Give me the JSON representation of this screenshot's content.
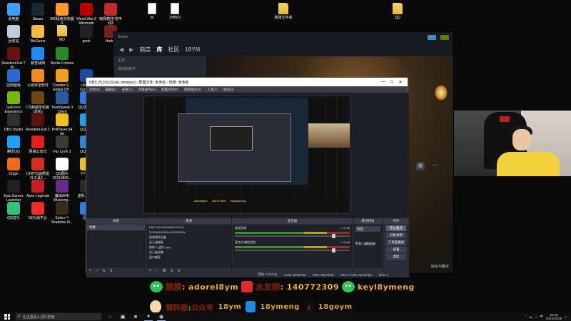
{
  "desktop": {
    "icons": [
      {
        "label": "此电脑",
        "color": "#3aa0ff"
      },
      {
        "label": "Steam",
        "color": "#1b2838"
      },
      {
        "label": "360极速浏览器X",
        "color": "#ff9a2a"
      },
      {
        "label": "World War Z Aftermath",
        "color": "#b00"
      },
      {
        "label": "暗网疯狂•地平线4",
        "color": "#c02a2a"
      },
      {
        "label": "回收站",
        "color": "#bcd"
      },
      {
        "label": "WeGame",
        "color": "#f4b942"
      },
      {
        "label": "MD",
        "color": "folder"
      },
      {
        "label": "geek",
        "color": "#222"
      },
      {
        "label": "Hades",
        "color": "#7a2020"
      },
      {
        "label": "Resident Evil 7 Bi...",
        "color": "#6a1010"
      },
      {
        "label": "暴雪战网",
        "color": "#1a8cff"
      },
      {
        "label": "Revits Fortune -...",
        "color": "#2a8a2a"
      },
      {
        "label": "控制面板",
        "color": "#2a6ad0"
      },
      {
        "label": "火绒安全软件",
        "color": "#f08a1a"
      },
      {
        "label": "Counter-S... Global Off...",
        "color": "#f0a020"
      },
      {
        "label": "Ubisoft Connect",
        "color": "#1a4aa0"
      },
      {
        "label": "GeForce Experience",
        "color": "#76b900"
      },
      {
        "label": "CS跑腿单机版(单机)",
        "color": "#6a4a10"
      },
      {
        "label": "TeamSpeak 3 Client",
        "color": "#2a5aa0"
      },
      {
        "label": "QQ浏览器",
        "color": "#2a7ae2"
      },
      {
        "label": "OBS Studio",
        "color": "#302e31"
      },
      {
        "label": "Resident Evil 2",
        "color": "#601010"
      },
      {
        "label": "PotPlayer 64 bit",
        "color": "#f0c020"
      },
      {
        "label": "QQ游戏",
        "color": "#2a9ae2"
      },
      {
        "label": "腾讯QQ",
        "color": "#1aa0ff"
      },
      {
        "label": "网易云音乐",
        "color": "#e02020"
      },
      {
        "label": "Far Cry® 3",
        "color": "#3a3a3a"
      },
      {
        "label": "QQ影音",
        "color": "#2a8ad0"
      },
      {
        "label": "Origin",
        "color": "#f06a1a"
      },
      {
        "label": "CF时代画质提升工具2...",
        "color": "#d03020"
      },
      {
        "label": "QQ图片20210805...",
        "color": "#ffffff"
      },
      {
        "label": "YY语音",
        "color": "#f0c020"
      },
      {
        "label": "Epic Games Launcher",
        "color": "#222"
      },
      {
        "label": "Apex Legends",
        "color": "#c02020"
      },
      {
        "label": "魔域ARK (Maiyong...",
        "color": "#6a2a8a"
      },
      {
        "label": "虚拟 3 设...",
        "color": "#2a2a2a"
      },
      {
        "label": "QQ音乐",
        "color": "#31c27c"
      },
      {
        "label": "5E对战平台",
        "color": "#f02a2a"
      },
      {
        "label": "Sekiro™ Shadows Di...",
        "color": "#3a2a1a"
      },
      {
        "label": "迅雷",
        "color": "#2a7ae2"
      },
      {
        "label": "ini",
        "color": "doc"
      },
      {
        "label": "ZHIBO",
        "color": "doc"
      },
      {
        "label": "新建文件夹",
        "color": "folder"
      },
      {
        "label": "QQ",
        "color": "folder"
      }
    ]
  },
  "steam": {
    "title_left": "Steam",
    "nav": [
      "商店",
      "库",
      "社区",
      "18YM"
    ],
    "sidebar_items": [
      "主页",
      "游戏和软件"
    ],
    "friends_label": "好友与聊天"
  },
  "obs": {
    "title": "OBS 25.0.8 (32-bit, windows) - 配置文件: 未命名 - 场景: 未命名",
    "menu": [
      "文件(F)",
      "编辑(E)",
      "查看(V)",
      "停靠部件(D)",
      "配置文件(P)",
      "场景集合(S)",
      "工具(T)",
      "帮助(H)"
    ],
    "docks": {
      "scenes": {
        "title": "场景",
        "items": [
          "场景"
        ]
      },
      "sources": {
        "title": "来源",
        "items": [
          "EASY1EDDSDAEDSOO/Q",
          "FOSNA1DDSAUOOURDSN",
          "视频捕获设备",
          "显示器捕获",
          "图像 2 (图片) ipg",
          "显示器采集",
          "窗口捕获"
        ]
      },
      "mixer": {
        "title": "混音器",
        "rows": [
          {
            "label": "桌面音频",
            "db": "0.0 dB"
          },
          {
            "label": "麦克风/辅助音频",
            "db": "0.0 dB"
          }
        ]
      },
      "transitions": {
        "title": "转场特效",
        "mode": "淡出",
        "duration_label": "时长",
        "duration": "300 ms"
      },
      "controls": {
        "title": "控件",
        "buttons": [
          "停止推流",
          "开始录制",
          "工作室模式",
          "设置",
          "退出"
        ]
      }
    },
    "status": {
      "dropped": "丢帧 0 (0.0%)",
      "live": "LIVE: 00:00:00",
      "rec": "REC: 00:00:00",
      "cpu": "CPU: 0.0%, 60.00 fps",
      "kbps": "kb/s: 0"
    }
  },
  "banner": {
    "wechat_label": "禁禁:",
    "wechat_id": "adorel8ym",
    "qq_group_label": "水友群:",
    "qq_group": "140772309",
    "wechat2": "keyl8ymeng",
    "ad_label": "调料器:公众号",
    "ad_name": "18ym",
    "bili": "18ymeng",
    "douyin": "18goym"
  },
  "taskbar": {
    "search_placeholder": "在这里输入进行搜索",
    "time": "22:19",
    "date": "2021/10/26",
    "ime": "中"
  }
}
